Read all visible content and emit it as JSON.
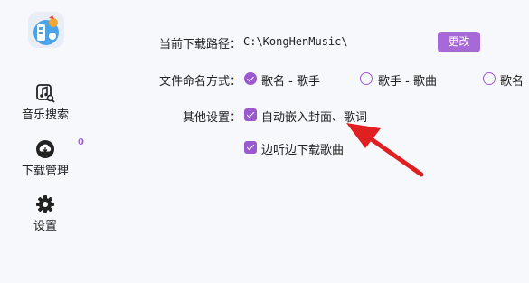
{
  "sidebar": {
    "logo_icon": "music-app-logo-icon",
    "items": [
      {
        "label": "音乐搜索",
        "icon": "music-search-icon"
      },
      {
        "label": "下载管理",
        "icon": "download-cloud-icon",
        "badge": "0"
      },
      {
        "label": "设置",
        "icon": "gear-icon"
      }
    ]
  },
  "settings": {
    "download_path": {
      "label": "当前下载路径：",
      "value": "C:\\KongHenMusic\\",
      "button": "更改"
    },
    "naming": {
      "label": "文件命名方式：",
      "options": [
        {
          "label": "歌名 - 歌手",
          "checked": true
        },
        {
          "label": "歌手 - 歌曲",
          "checked": false
        },
        {
          "label": "歌名",
          "checked": false
        }
      ]
    },
    "other": {
      "label": "其他设置：",
      "options": [
        {
          "label": "自动嵌入封面、歌词",
          "checked": true
        },
        {
          "label": "边听边下载歌曲",
          "checked": true
        }
      ]
    }
  },
  "colors": {
    "accent": "#9b59d0",
    "button": "#a869d8",
    "arrow": "#e02020",
    "background": "#f7f8fc"
  }
}
